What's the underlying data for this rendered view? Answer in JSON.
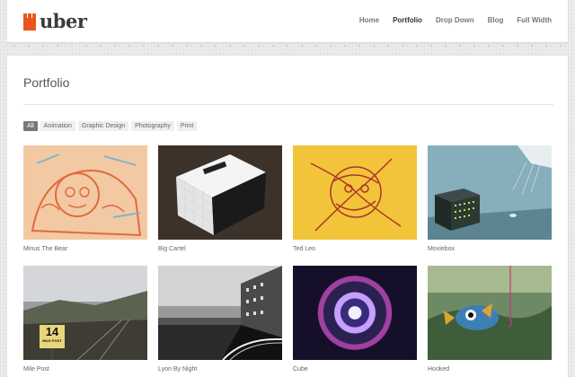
{
  "brand": {
    "name": "uber",
    "accent": "#e8561c"
  },
  "nav": {
    "items": [
      {
        "label": "Home",
        "active": false
      },
      {
        "label": "Portfolio",
        "active": true
      },
      {
        "label": "Drop Down",
        "active": false
      },
      {
        "label": "Blog",
        "active": false
      },
      {
        "label": "Full Width",
        "active": false
      }
    ]
  },
  "page": {
    "title": "Portfolio"
  },
  "filters": [
    {
      "label": "All",
      "active": true
    },
    {
      "label": "Animation",
      "active": false
    },
    {
      "label": "Graphic Design",
      "active": false
    },
    {
      "label": "Photography",
      "active": false
    },
    {
      "label": "Print",
      "active": false
    }
  ],
  "portfolio": [
    {
      "caption": "Minus The Bear",
      "thumb": "minus"
    },
    {
      "caption": "Big Cartel",
      "thumb": "big"
    },
    {
      "caption": "Ted Leo",
      "thumb": "ted"
    },
    {
      "caption": "Moviebox",
      "thumb": "movie"
    },
    {
      "caption": "Mile Post",
      "thumb": "mile"
    },
    {
      "caption": "Lyon By Night",
      "thumb": "lyon"
    },
    {
      "caption": "Cube",
      "thumb": "cube"
    },
    {
      "caption": "Hooked",
      "thumb": "hooked"
    }
  ],
  "thumb_text": {
    "mile_post_sign_number": "14",
    "mile_post_sign_label": "MILE POST"
  }
}
